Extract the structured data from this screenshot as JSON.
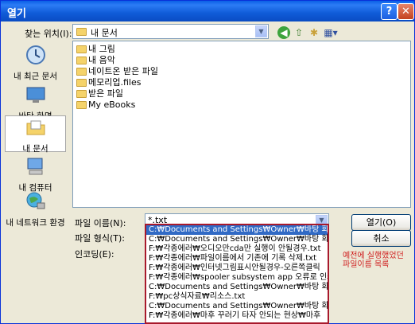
{
  "window": {
    "title": "열기",
    "help_glyph": "?",
    "close_glyph": "✕"
  },
  "lookin": {
    "label": "찾는 위치(I):",
    "value": "내 문서"
  },
  "places": [
    {
      "label": "내 최근 문서",
      "icon": "recent-documents-icon"
    },
    {
      "label": "바탕 화면",
      "icon": "desktop-icon"
    },
    {
      "label": "내 문서",
      "icon": "my-documents-icon"
    },
    {
      "label": "내 컴퓨터",
      "icon": "my-computer-icon"
    },
    {
      "label": "내 네트워크 환경",
      "icon": "network-icon"
    }
  ],
  "files": [
    "내 그림",
    "내 음악",
    "네이트온 받은 파일",
    "메모리업.files",
    "받은 파일",
    "My eBooks"
  ],
  "filename": {
    "label": "파일 이름(N):",
    "value": "*.txt"
  },
  "filetype": {
    "label": "파일 형식(T):"
  },
  "encoding": {
    "label": "인코딩(E):"
  },
  "buttons": {
    "open": "열기(O)",
    "cancel": "취소"
  },
  "autocomplete": [
    "C:₩Documents and Settings₩Owner₩바탕 화면₩",
    "C:₩Documents and Settings₩Owner₩바탕 화면₩",
    "F:₩각종에러₩오디오만cda만 실행이 안될경우.txt",
    "F:₩각종에러₩파일이름에서 기존에 기록 삭제.txt",
    "F:₩각종에러₩인터넷그림표시안될경우-오른쪽클릭",
    "F:₩각종에러₩spooler subsystem app 오류로 인쇄",
    "C:₩Documents and Settings₩Owner₩바탕 화면₩",
    "F:₩pc상식자료₩리소스.txt",
    "C:₩Documents and Settings₩Owner₩바탕 화면₩",
    "F:₩각종에러₩마후 꾸러기 타자 안되는 현상₩마후"
  ],
  "annotation": {
    "line1": "예전에 실행했었던",
    "line2": "파일이름 목록"
  }
}
